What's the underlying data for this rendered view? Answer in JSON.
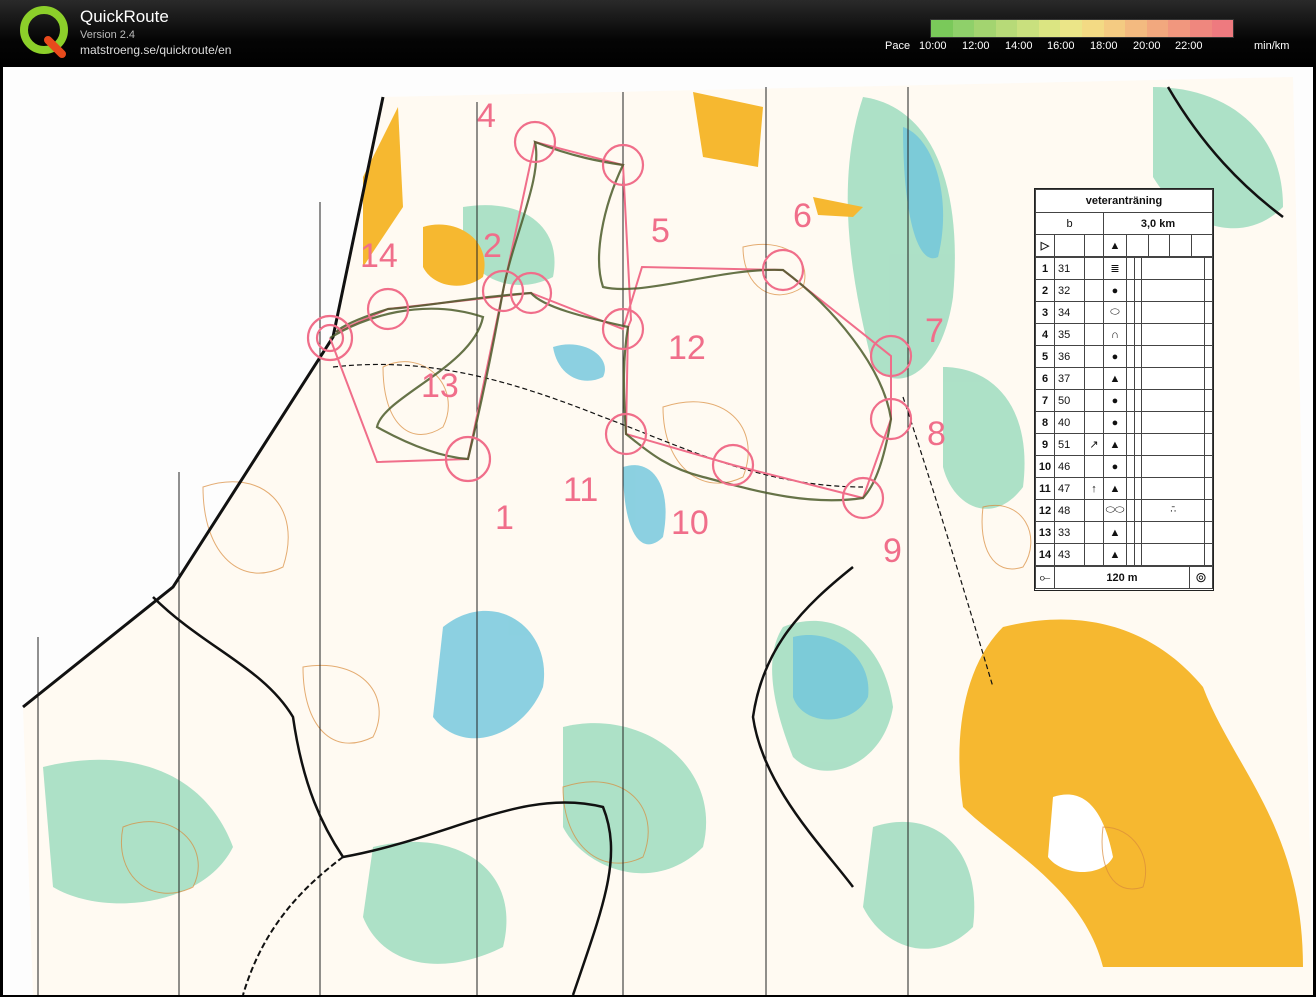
{
  "app": {
    "title": "QuickRoute",
    "version": "Version 2.4",
    "url": "matstroeng.se/quickroute/en"
  },
  "pace": {
    "label": "Pace",
    "ticks": [
      "10:00",
      "12:00",
      "14:00",
      "16:00",
      "18:00",
      "20:00",
      "22:00"
    ],
    "unit": "min/km",
    "colors": [
      "#7ac95a",
      "#8fd06a",
      "#a3d470",
      "#b7da78",
      "#c9e07e",
      "#dbe582",
      "#ebe588",
      "#f3da84",
      "#f4cb82",
      "#f3ba80",
      "#f2a87e",
      "#f1977e",
      "#ef877e",
      "#ee7a7f"
    ]
  },
  "map": {
    "course_color": "#f06e8a",
    "route_color": "#4b5a2a",
    "control_labels": [
      {
        "text": "1"
      },
      {
        "text": "2"
      },
      {
        "text": "4"
      },
      {
        "text": "5"
      },
      {
        "text": "6"
      },
      {
        "text": "7"
      },
      {
        "text": "8"
      },
      {
        "text": "9"
      },
      {
        "text": "10"
      },
      {
        "text": "11"
      },
      {
        "text": "12"
      },
      {
        "text": "13"
      },
      {
        "text": "14"
      }
    ]
  },
  "descriptions": {
    "title": "veteranträning",
    "class": "b",
    "distance": "3,0 km",
    "rows": [
      {
        "num": "1",
        "code": "31",
        "sym": "≣",
        "extra": ""
      },
      {
        "num": "2",
        "code": "32",
        "sym": "●",
        "extra": ""
      },
      {
        "num": "3",
        "code": "34",
        "sym": "⬭",
        "extra": ""
      },
      {
        "num": "4",
        "code": "35",
        "sym": "∩",
        "extra": ""
      },
      {
        "num": "5",
        "code": "36",
        "sym": "●",
        "extra": ""
      },
      {
        "num": "6",
        "code": "37",
        "sym": "▲",
        "extra": ""
      },
      {
        "num": "7",
        "code": "50",
        "sym": "●",
        "extra": ""
      },
      {
        "num": "8",
        "code": "40",
        "sym": "●",
        "extra": ""
      },
      {
        "num": "9",
        "code": "51",
        "pre": "↗",
        "sym": "▲",
        "extra": ""
      },
      {
        "num": "10",
        "code": "46",
        "sym": "●",
        "extra": ""
      },
      {
        "num": "11",
        "code": "47",
        "pre": "↑",
        "sym": "▲",
        "extra": ""
      },
      {
        "num": "12",
        "code": "48",
        "sym": "⬭⬭",
        "extra": "·̄·"
      },
      {
        "num": "13",
        "code": "33",
        "sym": "▲",
        "extra": ""
      },
      {
        "num": "14",
        "code": "43",
        "sym": "▲",
        "extra": ""
      }
    ],
    "start_sym": "▷",
    "start_feature": "▲",
    "finish_distance": "120 m"
  }
}
